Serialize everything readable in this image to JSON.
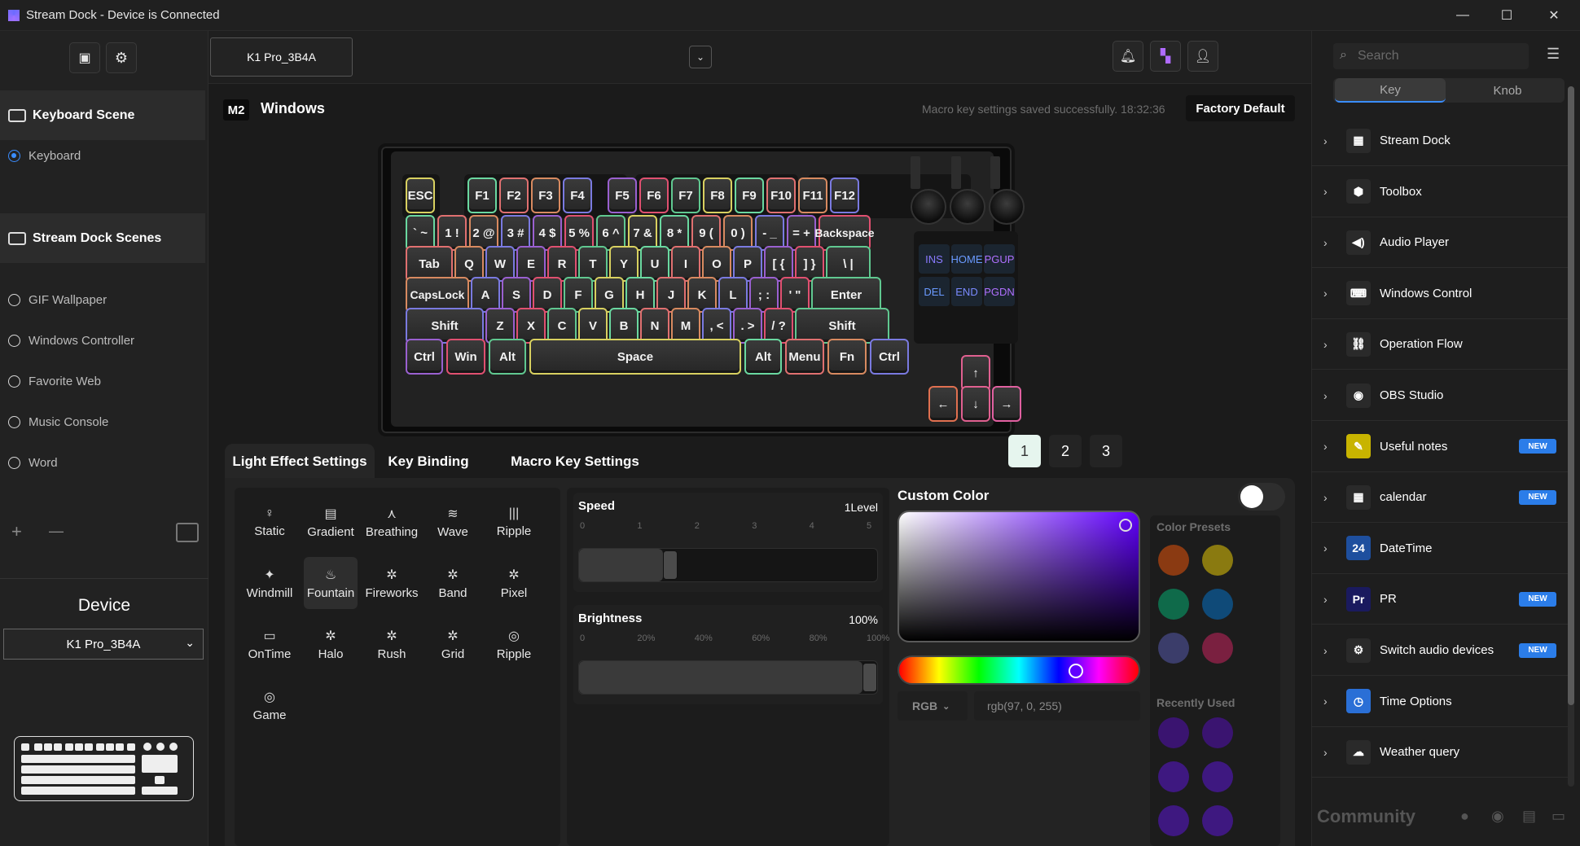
{
  "window": {
    "title": "Stream Dock - Device is Connected",
    "minimize": "—",
    "maximize": "☐",
    "close": "✕"
  },
  "sidebar": {
    "keyboard_scene": "Keyboard Scene",
    "keyboard_item": "Keyboard",
    "dock_scenes": "Stream Dock Scenes",
    "items": [
      "GIF Wallpaper",
      "Windows Controller",
      "Favorite Web",
      "Music Console",
      "Word"
    ],
    "add": "+",
    "remove": "—",
    "device_title": "Device",
    "device_select": "K1 Pro_3B4A"
  },
  "topbar": {
    "device_tab": "K1 Pro_3B4A",
    "dropdown": "⌄"
  },
  "header": {
    "mode_badge": "M2",
    "mode_name": "Windows",
    "status": "Macro key settings saved successfully. 18:32:36",
    "factory_default": "Factory Default"
  },
  "keyboard": {
    "rows": [
      [
        "ESC",
        "F1",
        "F2",
        "F3",
        "F4",
        "F5",
        "F6",
        "F7",
        "F8",
        "F9",
        "F10",
        "F11",
        "F12"
      ],
      [
        "` ~",
        "1 !",
        "2 @",
        "3 #",
        "4 $",
        "5 %",
        "6 ^",
        "7 &",
        "8 *",
        "9 (",
        "0 )",
        "- _",
        "= +",
        "Backspace"
      ],
      [
        "Tab",
        "Q",
        "W",
        "E",
        "R",
        "T",
        "Y",
        "U",
        "I",
        "O",
        "P",
        "[ {",
        "] }",
        "\\ |"
      ],
      [
        "CapsLock",
        "A",
        "S",
        "D",
        "F",
        "G",
        "H",
        "J",
        "K",
        "L",
        "; :",
        "' \"",
        "Enter"
      ],
      [
        "Shift",
        "Z",
        "X",
        "C",
        "V",
        "B",
        "N",
        "M",
        ", <",
        ". >",
        "/ ?",
        "Shift"
      ],
      [
        "Ctrl",
        "Win",
        "Alt",
        "Space",
        "Alt",
        "Menu",
        "Fn",
        "Ctrl"
      ]
    ],
    "nav": [
      "INS",
      "HOME",
      "PGUP",
      "DEL",
      "END",
      "PGDN"
    ],
    "arrows": [
      "↑",
      "←",
      "↓",
      "→"
    ]
  },
  "pages": [
    "1",
    "2",
    "3"
  ],
  "tabs": [
    "Light Effect Settings",
    "Key Binding",
    "Macro Key Settings"
  ],
  "effects": [
    "Static",
    "Gradient",
    "Breathing",
    "Wave",
    "Ripple",
    "Windmill",
    "Fountain",
    "Fireworks",
    "Band",
    "Pixel",
    "OnTime",
    "Halo",
    "Rush",
    "Grid",
    "Ripple",
    "Game"
  ],
  "effect_glyphs": [
    "♀",
    "▤",
    "⋏",
    "≋",
    "|||",
    "✦",
    "♨",
    "✲",
    "✲",
    "✲",
    "▭",
    "✲",
    "✲",
    "✲",
    "◎",
    "◎"
  ],
  "speed": {
    "label": "Speed",
    "value": "1Level",
    "ticks": [
      "0",
      "1",
      "2",
      "3",
      "4",
      "5"
    ],
    "level": 1,
    "max": 5
  },
  "brightness": {
    "label": "Brightness",
    "value": "100%",
    "ticks": [
      "0",
      "20%",
      "40%",
      "60%",
      "80%",
      "100%"
    ],
    "percent": 100
  },
  "color": {
    "title": "Custom Color",
    "mode": "RGB",
    "value": "rgb(97, 0, 255)",
    "presets_title": "Color Presets",
    "recent_title": "Recently Used",
    "presets": [
      "#8a3a12",
      "#8a7a10",
      "#0f6a4a",
      "#0f4a78",
      "#3b3d6a",
      "#7a2040"
    ],
    "recent": [
      "#3a1470",
      "#3a1470",
      "#3e1880",
      "#3e1880",
      "#3e1880",
      "#3e1880"
    ]
  },
  "rightpanel": {
    "search_placeholder": "Search",
    "segments": [
      "Key",
      "Knob"
    ],
    "plugins": [
      {
        "label": "Stream Dock",
        "new": false,
        "icon": "▦",
        "bg": "#2a2a2a"
      },
      {
        "label": "Toolbox",
        "new": false,
        "icon": "⬢",
        "bg": "#2a2a2a"
      },
      {
        "label": "Audio Player",
        "new": false,
        "icon": "◀)",
        "bg": "#2a2a2a"
      },
      {
        "label": "Windows Control",
        "new": false,
        "icon": "⌨",
        "bg": "#2a2a2a"
      },
      {
        "label": "Operation Flow",
        "new": false,
        "icon": "⛓",
        "bg": "#2a2a2a"
      },
      {
        "label": "OBS Studio",
        "new": false,
        "icon": "◉",
        "bg": "#2a2a2a"
      },
      {
        "label": "Useful notes",
        "new": true,
        "icon": "✎",
        "bg": "#c8b400"
      },
      {
        "label": "calendar",
        "new": true,
        "icon": "▦",
        "bg": "#2a2a2a"
      },
      {
        "label": "DateTime",
        "new": false,
        "icon": "24",
        "bg": "#1e4f9e"
      },
      {
        "label": "PR",
        "new": true,
        "icon": "Pr",
        "bg": "#1a1a5e"
      },
      {
        "label": "Switch audio devices",
        "new": true,
        "icon": "⚙",
        "bg": "#2a2a2a"
      },
      {
        "label": "Time Options",
        "new": false,
        "icon": "◷",
        "bg": "#2a6fd6"
      },
      {
        "label": "Weather query",
        "new": false,
        "icon": "☁",
        "bg": "#2a2a2a"
      }
    ],
    "new_label": "NEW",
    "community": "Community"
  }
}
